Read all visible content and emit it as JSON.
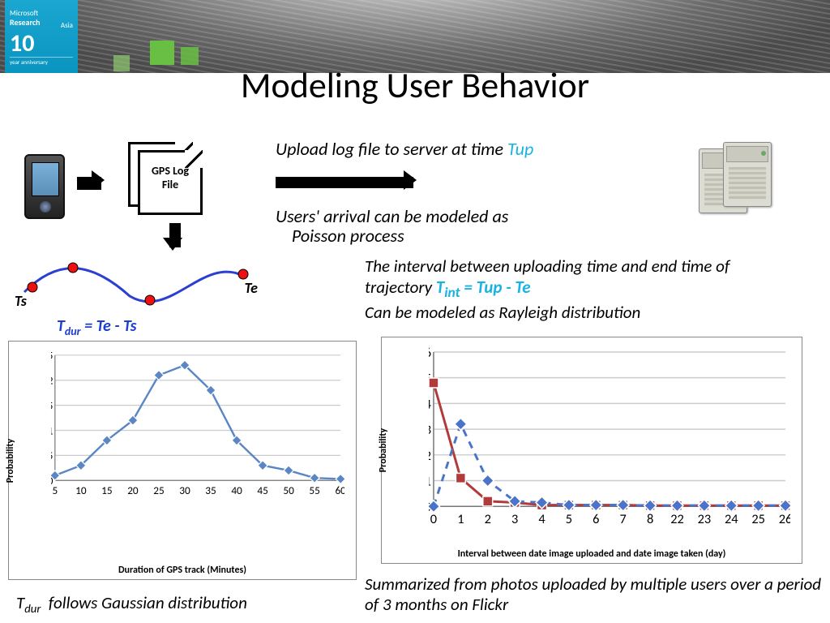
{
  "title": "Modeling User Behavior",
  "logo": {
    "brand": "Microsoft",
    "research": "Research",
    "asia": "Asia",
    "big": "10",
    "anniv": "year anniversary"
  },
  "docs_label": "GPS Log File",
  "upload_line_pre": "Upload log file to server at time ",
  "upload_tup": "Tup",
  "poisson_line1": "Users' arrival can be modeled as",
  "poisson_line2": "Poisson process",
  "traj_ts": "Ts",
  "traj_te": "Te",
  "tdur_expr": "Tdur = Te - Ts",
  "interval_line1": "The interval between uploading time and end time of",
  "interval_line2a": "trajectory  ",
  "interval_tint": "Tint = Tup - Te",
  "interval_line3": "Can be modeled as Rayleigh distribution",
  "gauss_note": "Tdur  follows Gaussian distribution",
  "flickr_note": "Summarized from photos uploaded by multiple users over a period of 3 months on Flickr",
  "chart_data": [
    {
      "type": "line",
      "title": "",
      "xlabel": "Duration of GPS track (Minutes)",
      "ylabel": "Probability",
      "categories": [
        5,
        10,
        15,
        20,
        25,
        30,
        35,
        40,
        45,
        50,
        55,
        60
      ],
      "values": [
        0.01,
        0.03,
        0.08,
        0.12,
        0.21,
        0.23,
        0.18,
        0.08,
        0.03,
        0.02,
        0.005,
        0.003
      ],
      "ylim": [
        0,
        0.25
      ],
      "color": "#5a86c5",
      "markers": "diamond"
    },
    {
      "type": "line",
      "title": "",
      "xlabel": "Interval between date image uploaded and date image taken (day)",
      "ylabel": "Probability",
      "categories": [
        0,
        1,
        2,
        3,
        4,
        5,
        6,
        7,
        8,
        22,
        23,
        24,
        25,
        26
      ],
      "series": [
        {
          "name": "solid",
          "color": "#b23a3a",
          "style": "solid",
          "marker": "square",
          "values": [
            0.48,
            0.11,
            0.02,
            0.015,
            0.005,
            0.005,
            0.005,
            0.005,
            0.003,
            0.003,
            0.003,
            0.003,
            0.003,
            0.003
          ]
        },
        {
          "name": "dashed",
          "color": "#4a74c9",
          "style": "dashed",
          "marker": "diamond",
          "values": [
            0.0,
            0.32,
            0.1,
            0.02,
            0.015,
            0.005,
            0.005,
            0.005,
            0.003,
            0.003,
            0.003,
            0.003,
            0.003,
            0.003
          ]
        }
      ],
      "ylim": [
        0,
        0.6
      ]
    }
  ]
}
